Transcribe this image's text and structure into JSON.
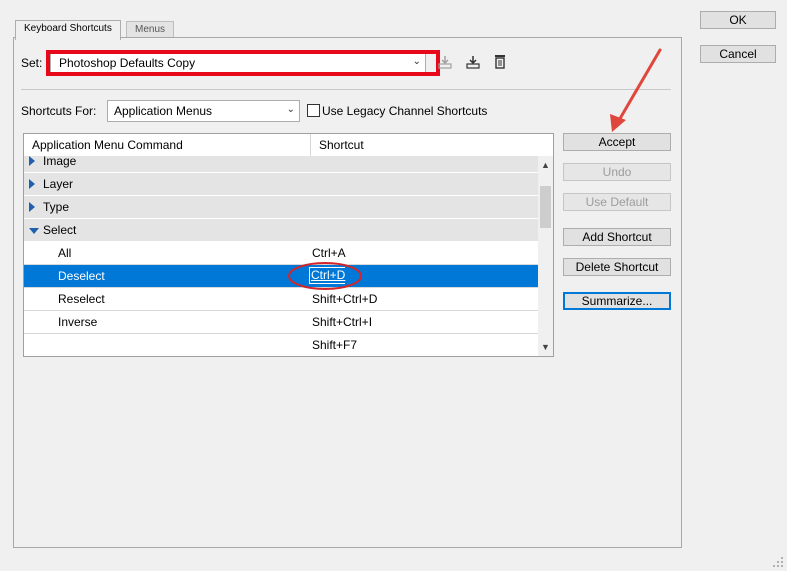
{
  "tabs": [
    {
      "label": "Keyboard Shortcuts"
    },
    {
      "label": "Menus"
    }
  ],
  "set": {
    "label": "Set:",
    "value": "Photoshop Defaults Copy"
  },
  "shortcuts_for": {
    "label": "Shortcuts For:",
    "value": "Application Menus"
  },
  "legacy_checkbox": {
    "label": "Use Legacy Channel Shortcuts",
    "checked": false
  },
  "table": {
    "columns": [
      "Application Menu Command",
      "Shortcut"
    ],
    "rows": [
      {
        "type": "group",
        "command": "Image",
        "shortcut": "",
        "expanded": false
      },
      {
        "type": "group",
        "command": "Layer",
        "shortcut": "",
        "expanded": false
      },
      {
        "type": "group",
        "command": "Type",
        "shortcut": "",
        "expanded": false
      },
      {
        "type": "group",
        "command": "Select",
        "shortcut": "",
        "expanded": true
      },
      {
        "type": "item",
        "command": "All",
        "shortcut": "Ctrl+A"
      },
      {
        "type": "item",
        "command": "Deselect",
        "shortcut": "Ctrl+D",
        "selected": true,
        "editing": true
      },
      {
        "type": "item",
        "command": "Reselect",
        "shortcut": "Shift+Ctrl+D"
      },
      {
        "type": "item",
        "command": "Inverse",
        "shortcut": "Shift+Ctrl+I"
      },
      {
        "type": "item",
        "command": "",
        "shortcut": "Shift+F7"
      }
    ]
  },
  "side_buttons": {
    "accept": "Accept",
    "undo": "Undo",
    "use_default": "Use Default",
    "add_shortcut": "Add Shortcut",
    "delete_shortcut": "Delete Shortcut",
    "summarize": "Summarize..."
  },
  "dialog_buttons": {
    "ok": "OK",
    "cancel": "Cancel"
  },
  "colors": {
    "selection": "#0078d7",
    "highlight_red": "#e8081c",
    "arrow_red": "#e0473c",
    "tree_triangle": "#1f5fae"
  }
}
